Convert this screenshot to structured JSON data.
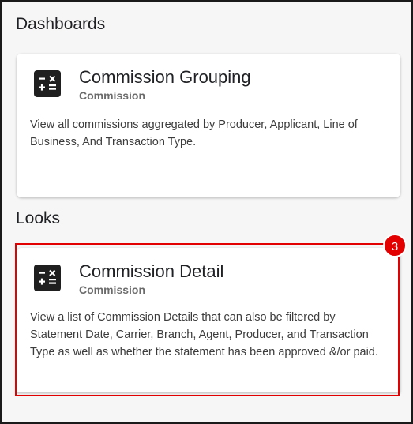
{
  "sections": {
    "dashboards_heading": "Dashboards",
    "looks_heading": "Looks"
  },
  "cards": {
    "grouping": {
      "icon": "calculator-icon",
      "title": "Commission Grouping",
      "subtitle": "Commission",
      "description": "View all commissions aggregated by Producer, Applicant, Line of Business, And Transaction Type."
    },
    "detail": {
      "icon": "calculator-icon",
      "title": "Commission Detail",
      "subtitle": "Commission",
      "description": "View a list of Commission Details that can also be filtered by Statement Date, Carrier, Branch, Agent, Producer, and Transaction Type as well as whether the statement has been approved &/or paid."
    }
  },
  "annotation": {
    "badge_number": "3",
    "highlight_color": "#e30000"
  }
}
